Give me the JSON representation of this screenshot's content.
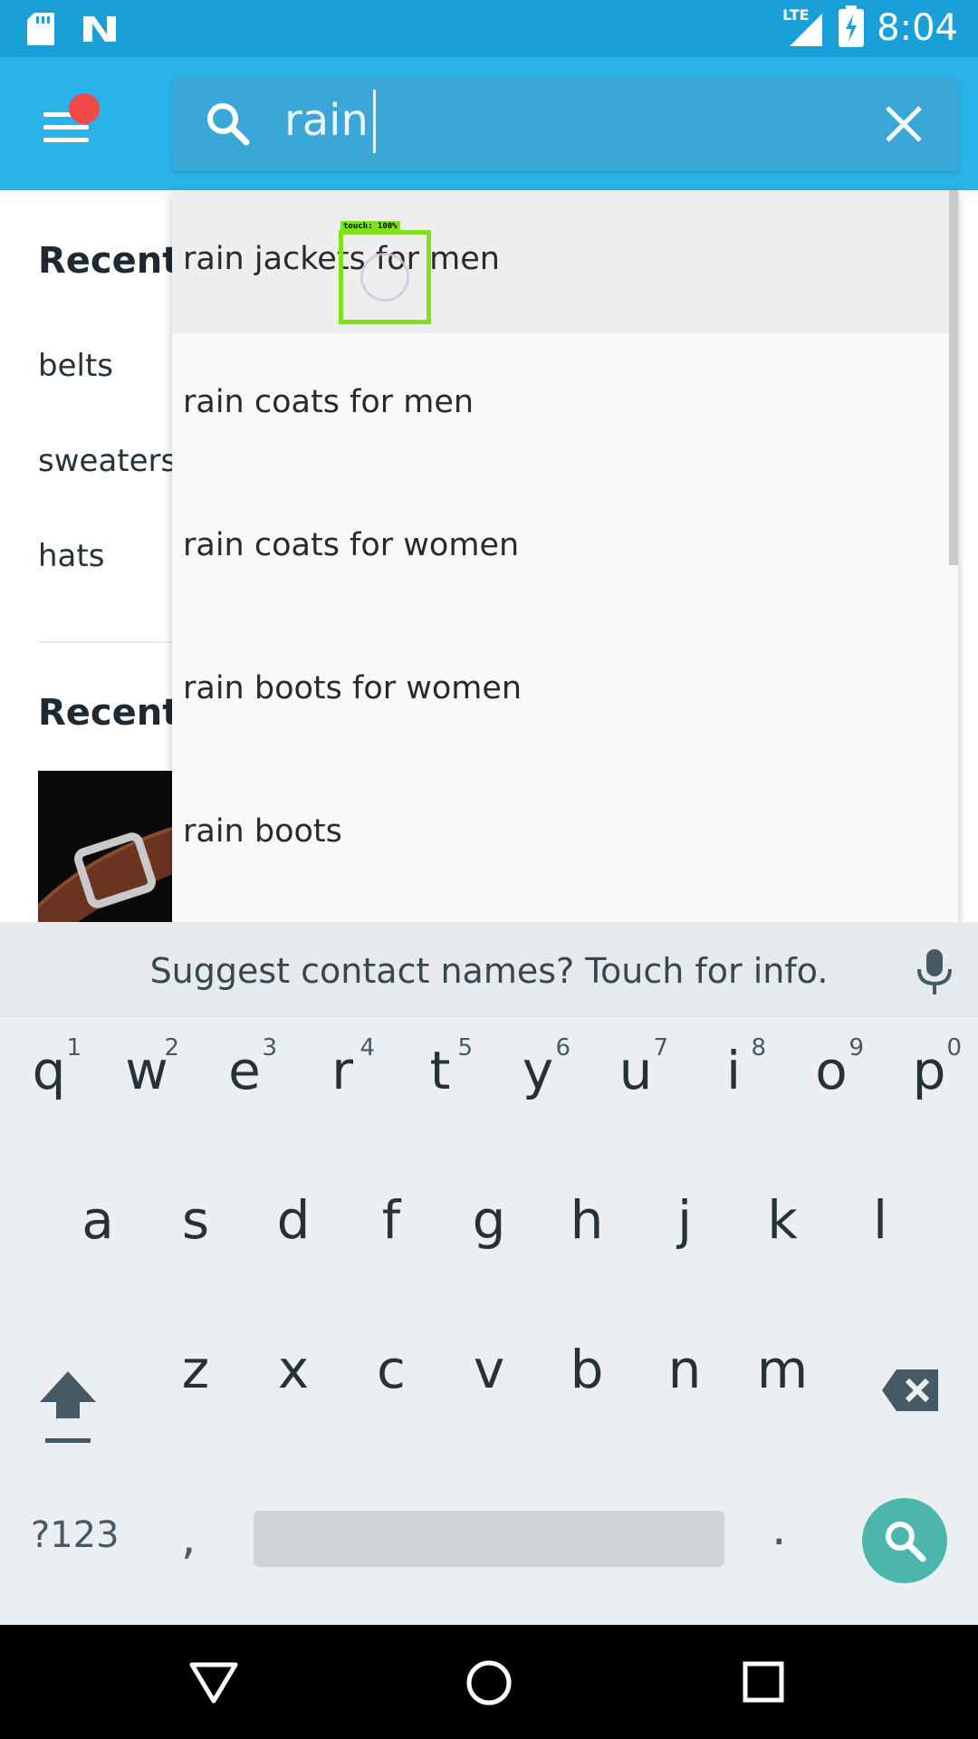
{
  "status_bar": {
    "time": "8:04",
    "network_label": "LTE",
    "icons": [
      "sd-card-icon",
      "notification-n-icon",
      "signal-icon",
      "battery-charging-icon"
    ]
  },
  "app_bar": {
    "menu_icon": "hamburger-menu-icon",
    "search": {
      "query": "rain",
      "clear_icon": "close-icon"
    }
  },
  "page": {
    "recent_heading": "Recent",
    "recent_items": [
      "belts",
      "sweaters",
      "hats"
    ],
    "recently_heading": "Recentl"
  },
  "suggestions": [
    "rain jackets for men",
    "rain coats for men",
    "rain coats for women",
    "rain boots for women",
    "rain boots"
  ],
  "touch_overlay": {
    "label": "touch: 100%"
  },
  "keyboard": {
    "suggestion_bar": "Suggest contact names? Touch for info.",
    "row1": [
      {
        "ch": "q",
        "num": "1"
      },
      {
        "ch": "w",
        "num": "2"
      },
      {
        "ch": "e",
        "num": "3"
      },
      {
        "ch": "r",
        "num": "4"
      },
      {
        "ch": "t",
        "num": "5"
      },
      {
        "ch": "y",
        "num": "6"
      },
      {
        "ch": "u",
        "num": "7"
      },
      {
        "ch": "i",
        "num": "8"
      },
      {
        "ch": "o",
        "num": "9"
      },
      {
        "ch": "p",
        "num": "0"
      }
    ],
    "row2": [
      "a",
      "s",
      "d",
      "f",
      "g",
      "h",
      "j",
      "k",
      "l"
    ],
    "row3": [
      "z",
      "x",
      "c",
      "v",
      "b",
      "n",
      "m"
    ],
    "symbols_key": "?123",
    "comma_key": ",",
    "period_key": "."
  },
  "colors": {
    "status_bar": "#1aa0d9",
    "app_bar": "#29b3e8",
    "search_field": "#3ba6d8",
    "notification_dot": "#f04a4a",
    "keyboard_bg": "#eceff1",
    "search_fab": "#4db6ac",
    "touch_indicator": "#7ee21a"
  }
}
